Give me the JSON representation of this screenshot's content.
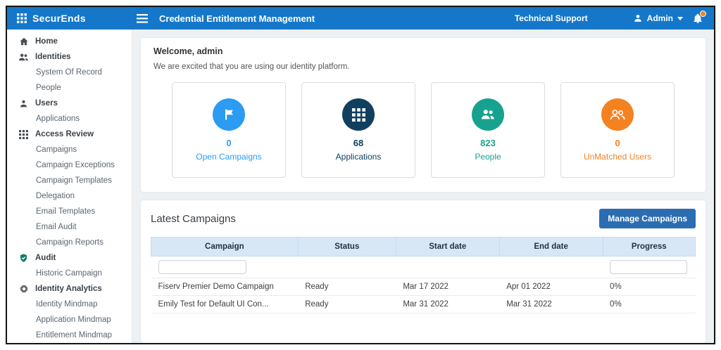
{
  "colors": {
    "header_blue": "#1577c9",
    "button_blue": "#2c6db2"
  },
  "header": {
    "brand": "SecurEnds",
    "title": "Credential Entitlement Management",
    "technical_support": "Technical Support",
    "user_label": "Admin"
  },
  "sidebar": {
    "items": [
      {
        "label": "Home",
        "icon": "home-icon"
      },
      {
        "label": "Identities",
        "icon": "identities-people-icon"
      },
      {
        "label": "System Of Record"
      },
      {
        "label": "People"
      },
      {
        "label": "Users",
        "icon": "user-icon"
      },
      {
        "label": "Applications"
      },
      {
        "label": "Access Review",
        "icon": "grid-icon"
      },
      {
        "label": "Campaigns"
      },
      {
        "label": "Campaign Exceptions"
      },
      {
        "label": "Campaign Templates"
      },
      {
        "label": "Delegation"
      },
      {
        "label": "Email Templates"
      },
      {
        "label": "Email Audit"
      },
      {
        "label": "Campaign Reports"
      },
      {
        "label": "Audit",
        "icon": "shield-icon"
      },
      {
        "label": "Historic Campaign"
      },
      {
        "label": "Identity Analytics",
        "icon": "gear-icon"
      },
      {
        "label": "Identity Mindmap"
      },
      {
        "label": "Application Mindmap"
      },
      {
        "label": "Entitlement Mindmap"
      }
    ]
  },
  "welcome": {
    "title": "Welcome, admin",
    "subtitle": "We are excited that you are using our identity platform."
  },
  "stats": [
    {
      "value": "0",
      "label": "Open Campaigns",
      "color": "#2b9cf2",
      "icon": "flag-icon"
    },
    {
      "value": "68",
      "label": "Applications",
      "color": "#11405f",
      "icon": "apps-grid-icon"
    },
    {
      "value": "823",
      "label": "People",
      "color": "#17a28f",
      "icon": "people-icon"
    },
    {
      "value": "0",
      "label": "UnMatched Users",
      "color": "#f58220",
      "icon": "unmatched-users-icon"
    }
  ],
  "campaigns": {
    "section_title": "Latest Campaigns",
    "manage_button": "Manage Campaigns",
    "columns": [
      "Campaign",
      "Status",
      "Start date",
      "End date",
      "Progress"
    ],
    "rows": [
      {
        "campaign": "Fiserv Premier Demo Campaign",
        "status": "Ready",
        "start_date": "Mar 17 2022",
        "end_date": "Apr 01 2022",
        "progress": "0%"
      },
      {
        "campaign": "Emily Test for Default UI Con...",
        "status": "Ready",
        "start_date": "Mar 31 2022",
        "end_date": "Mar 31 2022",
        "progress": "0%"
      }
    ]
  }
}
